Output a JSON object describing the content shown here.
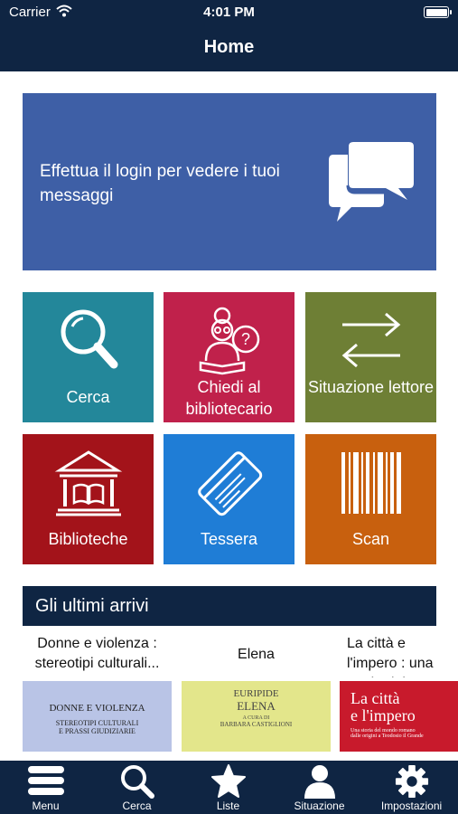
{
  "status_bar": {
    "carrier": "Carrier",
    "time": "4:01 PM"
  },
  "header": {
    "title": "Home"
  },
  "login_banner": {
    "text": "Effettua il login per vedere i tuoi messaggi",
    "icon": "chat-bubbles-icon",
    "color": "#3e5fa6"
  },
  "tiles": [
    {
      "label": "Cerca",
      "icon": "search-icon",
      "color": "#23879a"
    },
    {
      "label": "Chiedi al bibliotecario",
      "icon": "librarian-icon",
      "color": "#c0214b"
    },
    {
      "label": "Situazione lettore",
      "icon": "arrows-swap-icon",
      "color": "#6e7f35"
    },
    {
      "label": "Biblioteche",
      "icon": "library-building-icon",
      "color": "#a3131a"
    },
    {
      "label": "Tessera",
      "icon": "card-icon",
      "color": "#1f7dd6"
    },
    {
      "label": "Scan",
      "icon": "barcode-icon",
      "color": "#c8600e"
    }
  ],
  "latest_arrivals": {
    "title": "Gli ultimi arrivi",
    "items": [
      {
        "title": "Donne e violenza : stereotipi culturali...",
        "cover_text": [
          "DONNE E VIOLENZA",
          "STEREOTIPI CULTURALI",
          "E PRASSI GIUDIZIARIE"
        ],
        "cover_color": "#b9c4e6"
      },
      {
        "title": "Elena",
        "cover_text": [
          "EURIPIDE",
          "ELENA",
          "A CURA DI",
          "BARBARA CASTIGLIONI"
        ],
        "cover_color": "#e3e68b"
      },
      {
        "title": "La città e l'impero : una storia del...",
        "cover_text": [
          "La città",
          "e l'impero",
          "Una storia del mondo romano",
          "dalle origini a Teodosio il Grande"
        ],
        "cover_color": "#c81a2c"
      }
    ]
  },
  "tab_bar": [
    {
      "label": "Menu",
      "icon": "hamburger-icon"
    },
    {
      "label": "Cerca",
      "icon": "search-icon"
    },
    {
      "label": "Liste",
      "icon": "star-icon"
    },
    {
      "label": "Situazione",
      "icon": "person-icon"
    },
    {
      "label": "Impostazioni",
      "icon": "gear-icon"
    }
  ]
}
